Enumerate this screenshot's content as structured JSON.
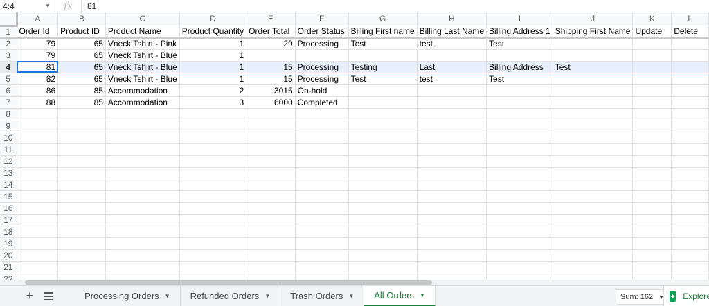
{
  "formula_bar": {
    "cell_ref": "4:4",
    "fx_label": "fx",
    "value": "81"
  },
  "columns": [
    "A",
    "B",
    "C",
    "D",
    "E",
    "F",
    "G",
    "H",
    "I",
    "J",
    "K",
    "L"
  ],
  "active_row": 4,
  "active_cell_col": 0,
  "rows": [
    {
      "n": "1",
      "cells": [
        "Order Id",
        "Product ID",
        "Product Name",
        "Product Quantity",
        "Order Total",
        "Order Status",
        "Billing First name",
        "Billing Last Name",
        "Billing Address 1",
        "Shipping First Name",
        "Update",
        "Delete"
      ]
    },
    {
      "n": "2",
      "cells": [
        "79",
        "65",
        "Vneck Tshirt - Pink",
        "1",
        "29",
        "Processing",
        "Test",
        "test",
        "Test",
        "",
        "",
        ""
      ]
    },
    {
      "n": "3",
      "cells": [
        "79",
        "65",
        "Vneck Tshirt - Blue",
        "1",
        "",
        "",
        "",
        "",
        "",
        "",
        "",
        ""
      ]
    },
    {
      "n": "4",
      "cells": [
        "81",
        "65",
        "Vneck Tshirt - Blue",
        "1",
        "15",
        "Processing",
        "Testing",
        "Last",
        "Billing Address",
        "Test",
        "",
        ""
      ]
    },
    {
      "n": "5",
      "cells": [
        "82",
        "65",
        "Vneck Tshirt - Blue",
        "1",
        "15",
        "Processing",
        "Test",
        "test",
        "Test",
        "",
        "",
        ""
      ]
    },
    {
      "n": "6",
      "cells": [
        "86",
        "85",
        "Accommodation",
        "2",
        "3015",
        "On-hold",
        "",
        "",
        "",
        "",
        "",
        ""
      ]
    },
    {
      "n": "7",
      "cells": [
        "88",
        "85",
        "Accommodation",
        "3",
        "6000",
        "Completed",
        "",
        "",
        "",
        "",
        "",
        ""
      ]
    },
    {
      "n": "8",
      "cells": [
        "",
        "",
        "",
        "",
        "",
        "",
        "",
        "",
        "",
        "",
        "",
        ""
      ]
    },
    {
      "n": "9",
      "cells": [
        "",
        "",
        "",
        "",
        "",
        "",
        "",
        "",
        "",
        "",
        "",
        ""
      ]
    },
    {
      "n": "10",
      "cells": [
        "",
        "",
        "",
        "",
        "",
        "",
        "",
        "",
        "",
        "",
        "",
        ""
      ]
    },
    {
      "n": "11",
      "cells": [
        "",
        "",
        "",
        "",
        "",
        "",
        "",
        "",
        "",
        "",
        "",
        ""
      ]
    },
    {
      "n": "12",
      "cells": [
        "",
        "",
        "",
        "",
        "",
        "",
        "",
        "",
        "",
        "",
        "",
        ""
      ]
    },
    {
      "n": "13",
      "cells": [
        "",
        "",
        "",
        "",
        "",
        "",
        "",
        "",
        "",
        "",
        "",
        ""
      ]
    },
    {
      "n": "14",
      "cells": [
        "",
        "",
        "",
        "",
        "",
        "",
        "",
        "",
        "",
        "",
        "",
        ""
      ]
    },
    {
      "n": "15",
      "cells": [
        "",
        "",
        "",
        "",
        "",
        "",
        "",
        "",
        "",
        "",
        "",
        ""
      ]
    },
    {
      "n": "16",
      "cells": [
        "",
        "",
        "",
        "",
        "",
        "",
        "",
        "",
        "",
        "",
        "",
        ""
      ]
    },
    {
      "n": "17",
      "cells": [
        "",
        "",
        "",
        "",
        "",
        "",
        "",
        "",
        "",
        "",
        "",
        ""
      ]
    },
    {
      "n": "18",
      "cells": [
        "",
        "",
        "",
        "",
        "",
        "",
        "",
        "",
        "",
        "",
        "",
        ""
      ]
    },
    {
      "n": "19",
      "cells": [
        "",
        "",
        "",
        "",
        "",
        "",
        "",
        "",
        "",
        "",
        "",
        ""
      ]
    },
    {
      "n": "20",
      "cells": [
        "",
        "",
        "",
        "",
        "",
        "",
        "",
        "",
        "",
        "",
        "",
        ""
      ]
    },
    {
      "n": "21",
      "cells": [
        "",
        "",
        "",
        "",
        "",
        "",
        "",
        "",
        "",
        "",
        "",
        ""
      ]
    },
    {
      "n": "22",
      "cells": [
        "",
        "",
        "",
        "",
        "",
        "",
        "",
        "",
        "",
        "",
        "",
        ""
      ]
    }
  ],
  "numeric_columns": [
    0,
    1,
    3,
    4
  ],
  "tabs": [
    {
      "label": "Processing Orders",
      "active": false
    },
    {
      "label": "Refunded Orders",
      "active": false
    },
    {
      "label": "Trash Orders",
      "active": false
    },
    {
      "label": "All Orders",
      "active": true
    }
  ],
  "status": {
    "sum_label": "Sum: 162",
    "explore_label": "Explore"
  },
  "colors": {
    "active_tab": "#188038",
    "selection": "#1a73e8"
  }
}
